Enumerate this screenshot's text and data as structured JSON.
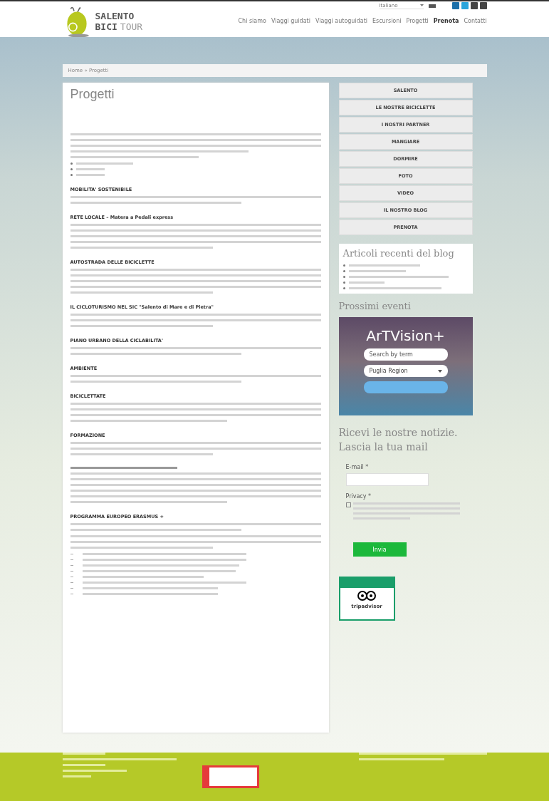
{
  "header": {
    "logo_line1": "SALENTO",
    "logo_line2": "BICI",
    "logo_line3": "TOUR",
    "language": "Italiano",
    "nav": [
      {
        "label": "Chi siamo",
        "selected": false
      },
      {
        "label": "Viaggi guidati",
        "selected": false
      },
      {
        "label": "Viaggi autoguidati",
        "selected": false
      },
      {
        "label": "Escursioni",
        "selected": false
      },
      {
        "label": "Progetti",
        "selected": false
      },
      {
        "label": "Prenota",
        "selected": true
      },
      {
        "label": "Contatti",
        "selected": false
      }
    ]
  },
  "breadcrumb": "Home » Progetti",
  "main": {
    "title": "Progetti",
    "blocks": [
      {
        "kind": "intro"
      },
      {
        "kind": "bullets3"
      },
      {
        "kind": "heading",
        "text": "MOBILITA' SOSTENIBILE"
      },
      {
        "kind": "para2"
      },
      {
        "kind": "heading",
        "text": "RETE LOCALE – Matera a Pedali express"
      },
      {
        "kind": "para5"
      },
      {
        "kind": "heading",
        "text": "AUTOSTRADA DELLE BICICLETTE"
      },
      {
        "kind": "para5"
      },
      {
        "kind": "heading",
        "text": "IL CICLOTURISMO NEL SIC \"Salento di Mare e di Pietra\""
      },
      {
        "kind": "para3"
      },
      {
        "kind": "heading",
        "text": "PIANO URBANO DELLA CICLABILITA'"
      },
      {
        "kind": "para2"
      },
      {
        "kind": "heading",
        "text": "AMBIENTE"
      },
      {
        "kind": "para2"
      },
      {
        "kind": "heading",
        "text": "BICICLETTATE"
      },
      {
        "kind": "para4"
      },
      {
        "kind": "heading",
        "text": "FORMAZIONE"
      },
      {
        "kind": "para3"
      },
      {
        "kind": "blurhead"
      },
      {
        "kind": "para6"
      },
      {
        "kind": "heading",
        "text": "PROGRAMMA EUROPEO ERASMUS +"
      },
      {
        "kind": "para2"
      },
      {
        "kind": "para3"
      },
      {
        "kind": "dashes8"
      }
    ]
  },
  "sidebar": {
    "menu": [
      "SALENTO",
      "LE NOSTRE BICICLETTE",
      "I NOSTRI PARTNER",
      "MANGIARE",
      "DORMIRE",
      "FOTO",
      "VIDEO",
      "IL NOSTRO BLOG",
      "PRENOTA"
    ],
    "blog_title": "Articoli recenti del blog",
    "events_title": "Prossimi eventi",
    "widget": {
      "title": "ArTVision+",
      "search_placeholder": "Search by term",
      "region": "Puglia Region"
    },
    "newsletter_title": "Ricevi le nostre notizie. Lascia la tua mail",
    "email_label": "E-mail *",
    "privacy_label": "Privacy *",
    "privacy_checked": false,
    "submit": "Invia",
    "badge_brand": "tripadvisor"
  }
}
